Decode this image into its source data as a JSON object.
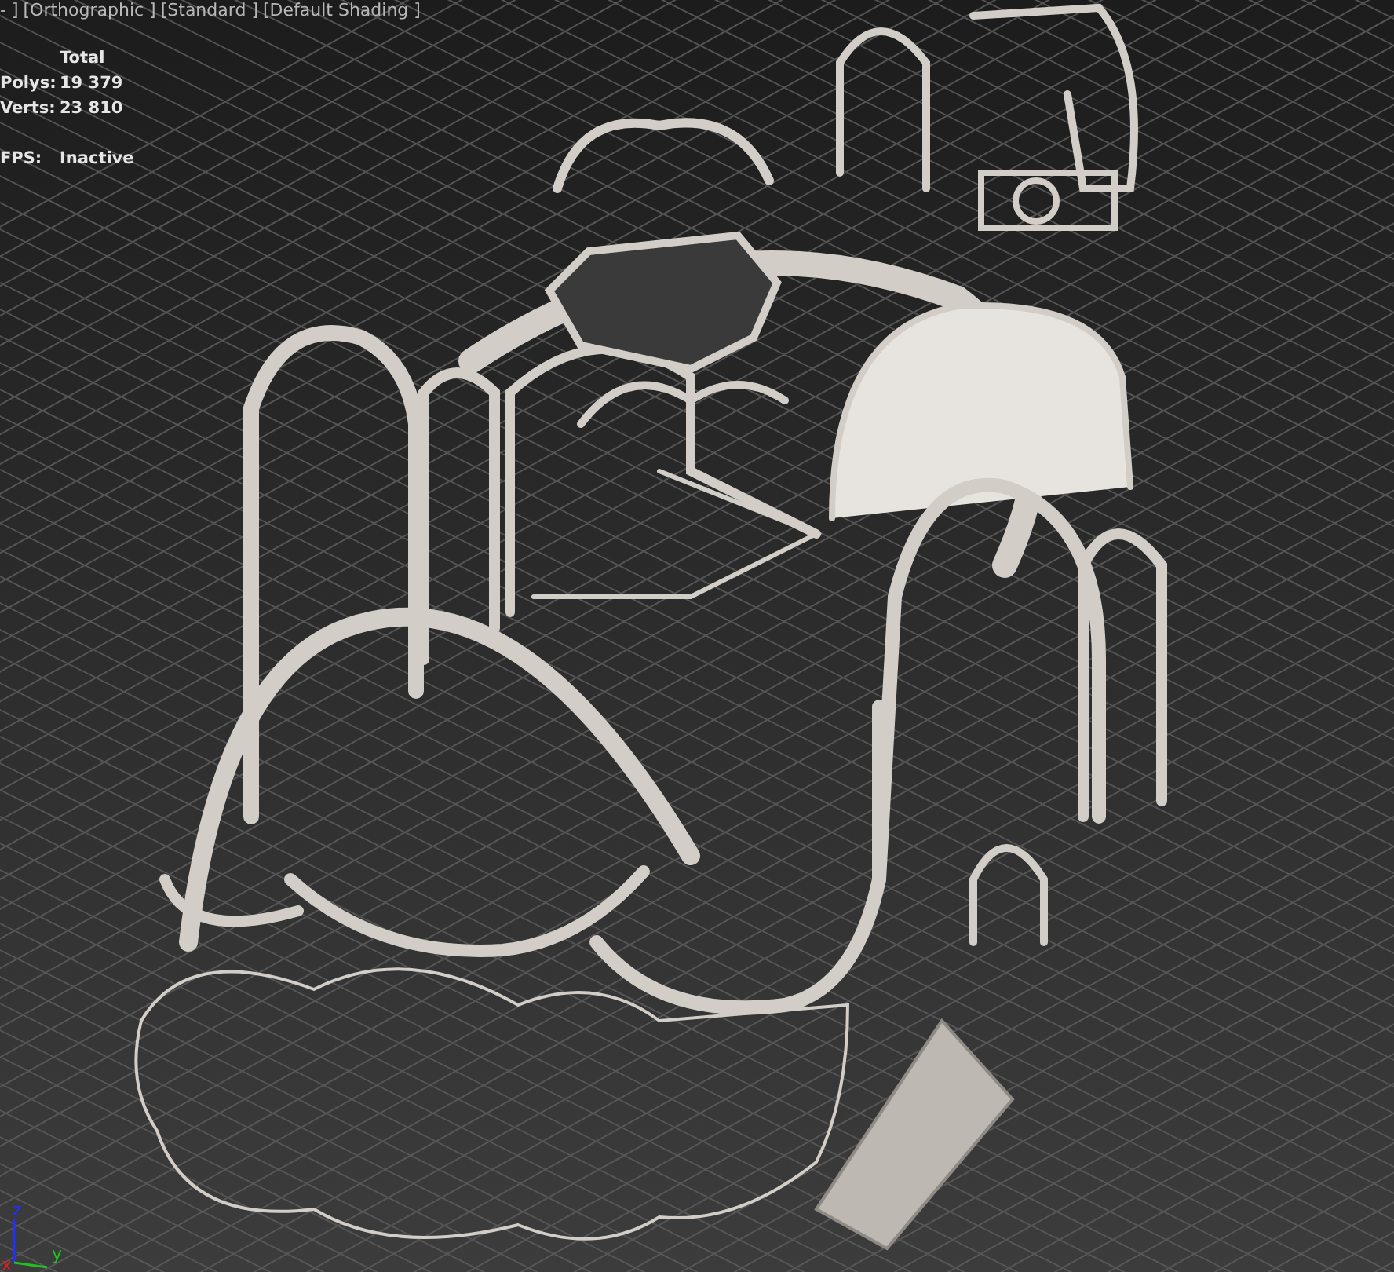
{
  "viewport": {
    "labels": [
      "- ]",
      "[Orthographic ]",
      "[Standard ]",
      "[Default Shading ]"
    ]
  },
  "stats": {
    "header": "Total",
    "rows": [
      {
        "label": "Polys:",
        "value": "19 379"
      },
      {
        "label": "Verts:",
        "value": "23 810"
      }
    ],
    "fps": {
      "label": "FPS:",
      "value": "Inactive"
    }
  },
  "axis_gizmo": {
    "x": "x",
    "y": "y",
    "z": "z"
  }
}
